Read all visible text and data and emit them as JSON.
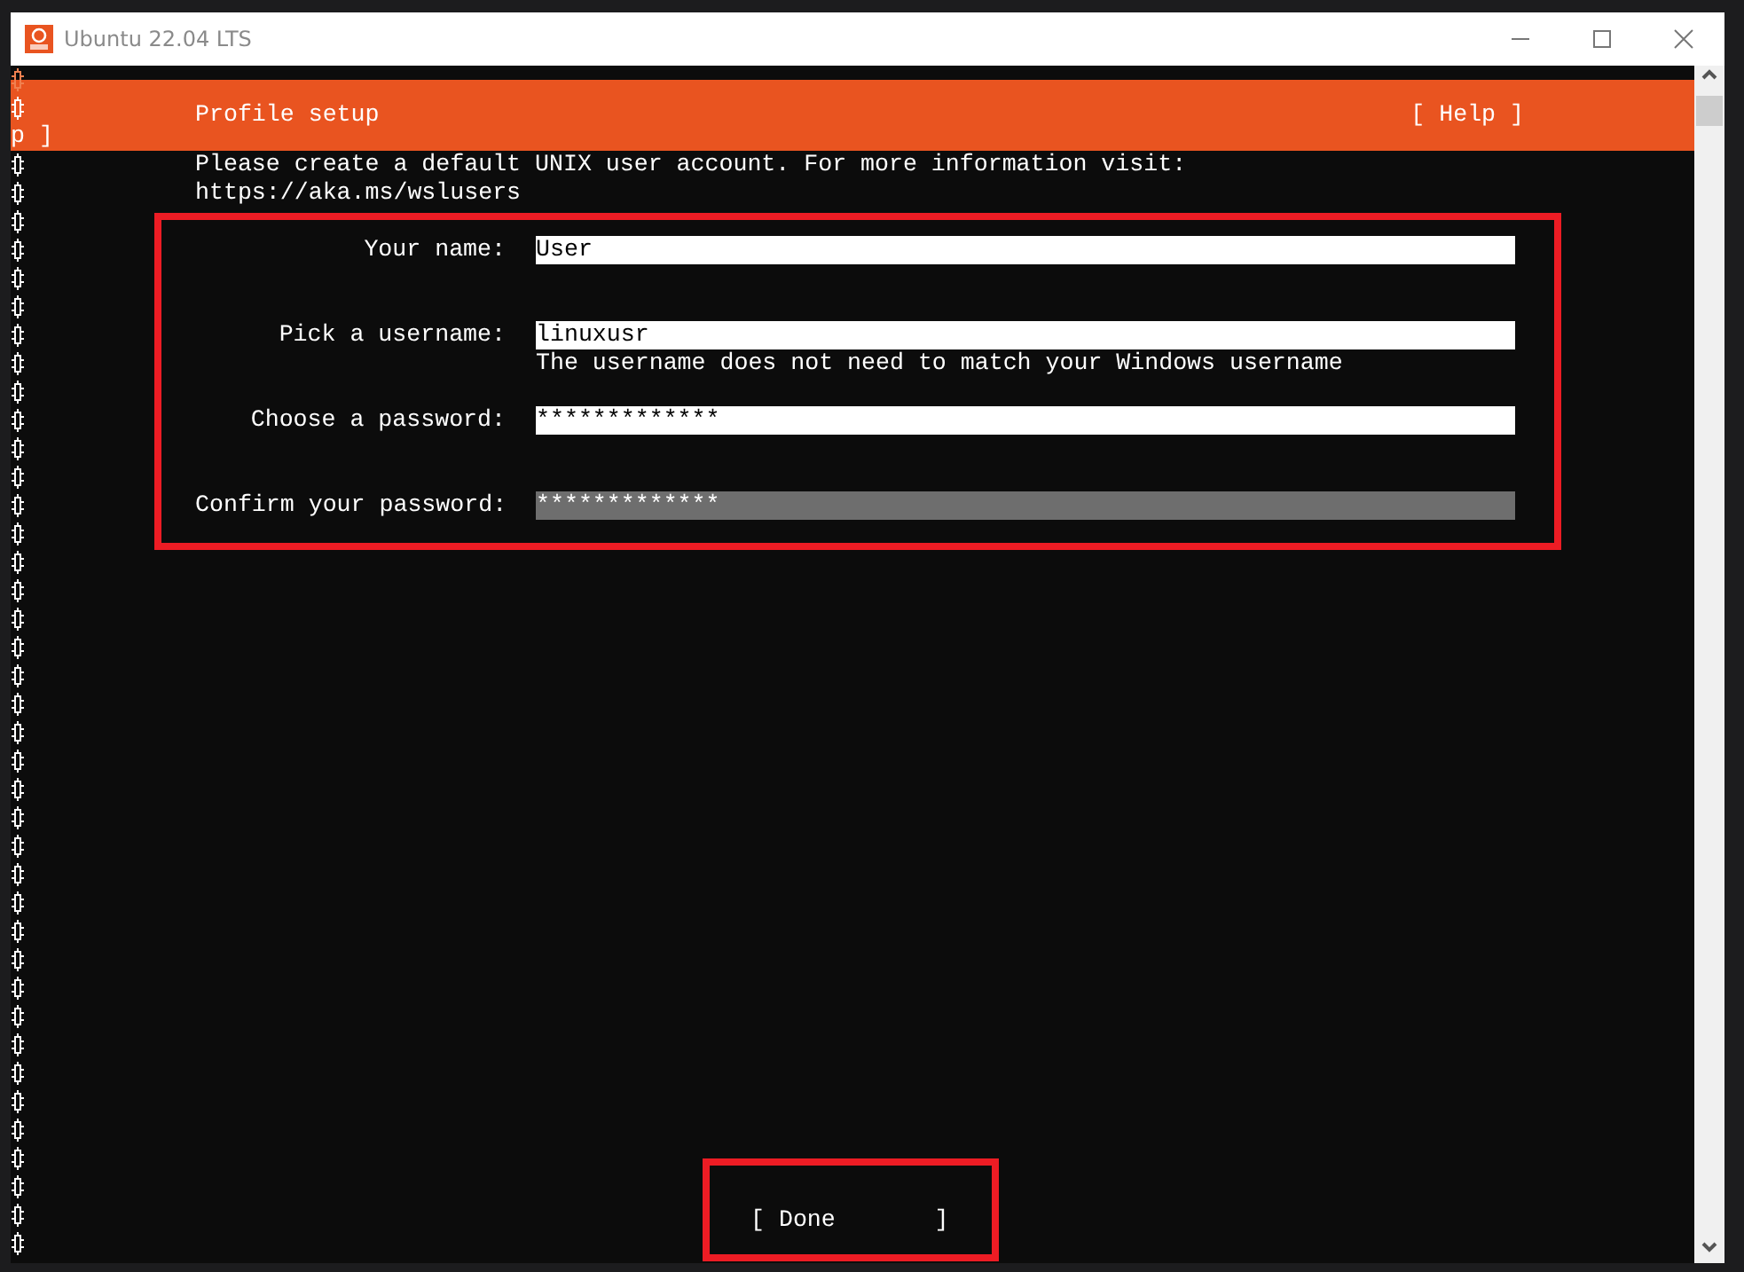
{
  "window": {
    "title": "Ubuntu 22.04 LTS"
  },
  "header": {
    "title": "Profile setup",
    "help": "[ Help ]"
  },
  "stray_text": "p ]",
  "intro": [
    "Please create a default UNIX user account. For more information visit:",
    "https://aka.ms/wslusers"
  ],
  "fields": [
    {
      "label": "Your name:",
      "value": "User",
      "focused": false
    },
    {
      "label": "Pick a username:",
      "value": "linuxusr",
      "focused": false,
      "hint": "The username does not need to match your Windows username"
    },
    {
      "label": "Choose a password:",
      "value": "*************",
      "focused": false
    },
    {
      "label": "Confirm your password:",
      "value": "*************",
      "focused": true
    }
  ],
  "done_button": "[ Done       ]"
}
